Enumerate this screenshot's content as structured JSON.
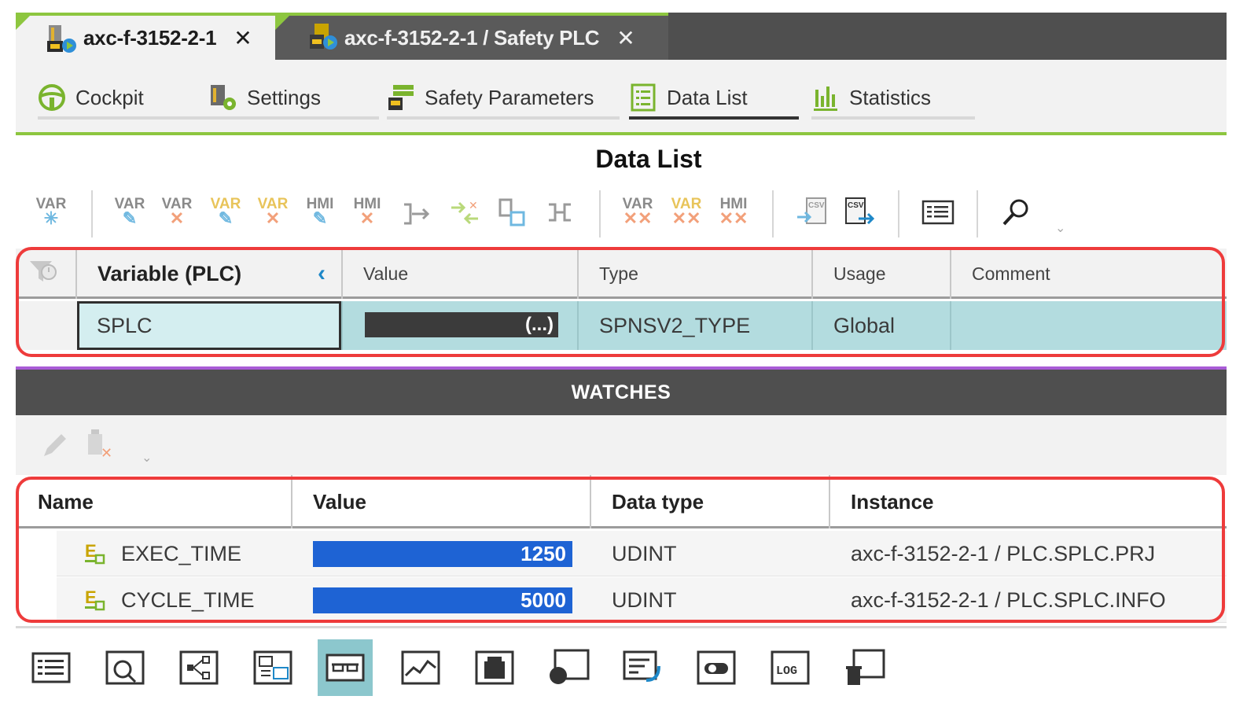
{
  "doc_tabs": [
    {
      "label": "axc-f-3152-2-1",
      "close": "✕",
      "icon": "plc-device-icon"
    },
    {
      "label": "axc-f-3152-2-1 / Safety PLC",
      "close": "✕",
      "icon": "safety-plc-icon"
    }
  ],
  "editor_tabs": [
    {
      "label": "Cockpit",
      "icon": "cockpit-icon"
    },
    {
      "label": "Settings",
      "icon": "settings-icon"
    },
    {
      "label": "Safety Parameters",
      "icon": "safety-parameters-icon"
    },
    {
      "label": "Data List",
      "icon": "data-list-icon",
      "active": true
    },
    {
      "label": "Statistics",
      "icon": "statistics-icon"
    }
  ],
  "data_list": {
    "title": "Data List",
    "toolbar": {
      "var": "VAR",
      "hmi": "HMI",
      "csv": "CSV"
    },
    "columns": [
      "Variable (PLC)",
      "Value",
      "Type",
      "Usage",
      "Comment"
    ],
    "rows": [
      {
        "variable": "SPLC",
        "value": "(...)",
        "type": "SPNSV2_TYPE",
        "usage": "Global",
        "comment": ""
      }
    ]
  },
  "watches": {
    "title": "WATCHES",
    "columns": [
      "Name",
      "Value",
      "Data type",
      "Instance"
    ],
    "rows": [
      {
        "name": "EXEC_TIME",
        "value": "1250",
        "data_type": "UDINT",
        "instance": "axc-f-3152-2-1 / PLC.SPLC.PRJ"
      },
      {
        "name": "CYCLE_TIME",
        "value": "5000",
        "data_type": "UDINT",
        "instance": "axc-f-3152-2-1 / PLC.SPLC.INFO"
      }
    ]
  },
  "dock": {
    "log_label": "LOG",
    "items": [
      "list-icon",
      "search-window-icon",
      "network-icon",
      "compare-icon",
      "watch-glasses-icon",
      "trend-icon",
      "weight-icon",
      "breakpoint-icon",
      "edit-window-icon",
      "toggle-icon",
      "log-icon",
      "trash-window-icon"
    ]
  },
  "colors": {
    "accent_green": "#8dc63f",
    "selection_teal": "#b3dcdf",
    "watch_value_blue": "#1e63d4",
    "highlight_red": "#ee3b3b",
    "divider_purple": "#a95bd6"
  }
}
